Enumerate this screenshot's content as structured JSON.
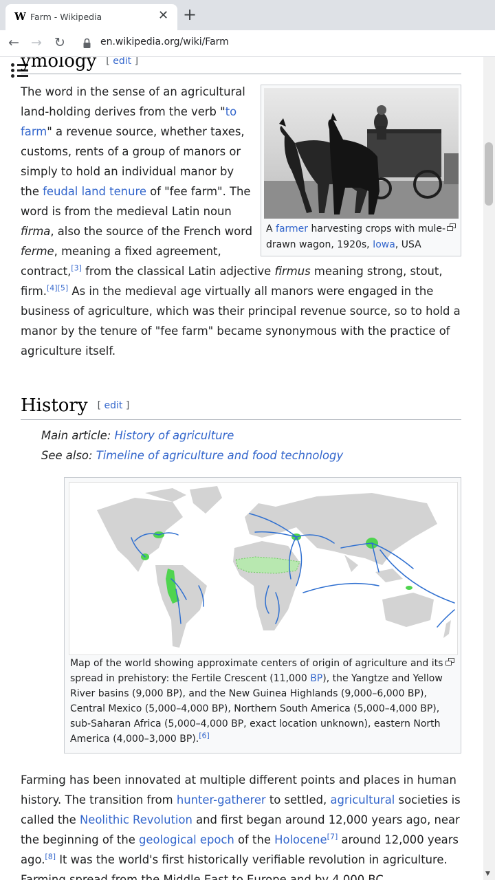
{
  "browser": {
    "tab_favicon": "W",
    "tab_title": "Farm - Wikipedia",
    "tab_close": "✕",
    "new_tab": "+",
    "back": "←",
    "forward": "→",
    "reload": "↻",
    "url": "en.wikipedia.org/wiki/Farm"
  },
  "etymology": {
    "heading": "ymology",
    "edit_open": "[",
    "edit_label": "edit",
    "edit_close": "]",
    "p1_a": "The word in the sense of an agricultural land-holding derives from the verb \"",
    "link_to_farm": "to farm",
    "p1_b": "\" a revenue source, whether taxes, customs, rents of a group of manors or simply to hold an individual manor by the ",
    "link_feudal": "feudal land tenure",
    "p1_c": " of \"fee farm\". The word is from the medieval Latin noun ",
    "em_firma": "firma",
    "p1_d": ", also the source of the French word ",
    "em_ferme": "ferme",
    "p1_e": ", meaning a fixed agreement, contract,",
    "ref3": "[3]",
    "p1_f": " from the classical Latin adjective ",
    "em_firmus": "firmus",
    "p1_g": " meaning strong, stout, firm.",
    "ref4": "[4]",
    "ref5": "[5]",
    "p1_h": " As in the medieval age virtually all manors were engaged in the business of agriculture, which was their principal revenue source, so to hold a manor by the tenure of \"fee farm\" became synonymous with the practice of agriculture itself."
  },
  "farmer_figure": {
    "cap_a": "A ",
    "link_farmer": "farmer",
    "cap_b": " harvesting crops with mule-drawn wagon, 1920s, ",
    "link_iowa": "Iowa",
    "cap_c": ", USA"
  },
  "history": {
    "heading": "History",
    "edit_open": "[",
    "edit_label": "edit",
    "edit_close": "]",
    "main_prefix": "Main article: ",
    "main_link": "History of agriculture",
    "see_prefix": "See also: ",
    "see_link": "Timeline of agriculture and food technology",
    "p_a": "Farming has been innovated at multiple different points and places in human history. The transition from ",
    "link_hunter": "hunter-gatherer",
    "p_b": " to settled, ",
    "link_agricultural": "agricultural",
    "p_c": " societies is called the ",
    "link_neolithic": "Neolithic Revolution",
    "p_d": " and first began around 12,000 years ago, near the beginning of the ",
    "link_epoch": "geological epoch",
    "p_e": " of the ",
    "link_holocene": "Holocene",
    "ref7": "[7]",
    "p_f": " around 12,000 years ago.",
    "ref8": "[8]",
    "p_g": " It was the world's first historically verifiable revolution in agriculture. Farming spread from the Middle East to Europe and by 4,000 BC"
  },
  "map_figure": {
    "cap_a": "Map of the world showing approximate centers of origin of agriculture and its spread in prehistory: the Fertile Crescent (11,000 ",
    "link_bp": "BP",
    "cap_b": "), the Yangtze and Yellow River basins (9,000 BP), and the New Guinea Highlands (9,000–6,000 BP), Central Mexico (5,000–4,000 BP), Northern South America (5,000–4,000 BP), sub-Saharan Africa (5,000–4,000 BP, exact location unknown), eastern North America (4,000–3,000 BP).",
    "ref6": "[6]"
  },
  "colors": {
    "link": "#3366cc",
    "land": "#d3d3d3",
    "origin": "#4fd44f",
    "arrow": "#2e6fd0"
  }
}
